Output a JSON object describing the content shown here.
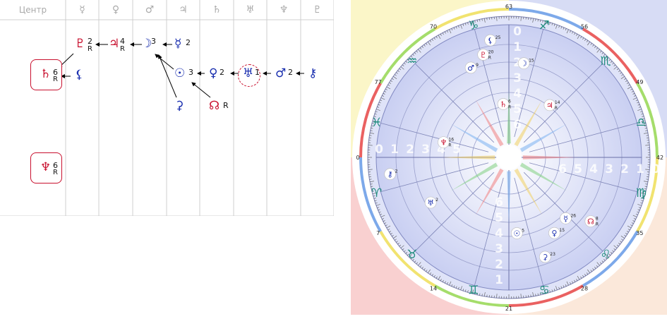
{
  "table": {
    "columns": [
      {
        "label": "Центр",
        "icon": "center-label"
      },
      {
        "label": "☿",
        "icon": "mercury-icon"
      },
      {
        "label": "♀",
        "icon": "venus-icon"
      },
      {
        "label": "♂",
        "icon": "mars-icon"
      },
      {
        "label": "♃",
        "icon": "jupiter-icon"
      },
      {
        "label": "♄",
        "icon": "saturn-icon"
      },
      {
        "label": "♅",
        "icon": "uranus-icon"
      },
      {
        "label": "♆",
        "icon": "neptune-icon"
      },
      {
        "label": "♇",
        "icon": "pluto-icon"
      }
    ],
    "nodes": {
      "pluto": {
        "glyph": "♇",
        "num": "2",
        "r": "R"
      },
      "jupiter": {
        "glyph": "♃",
        "num": "4",
        "r": "R"
      },
      "moon": {
        "glyph": "☽",
        "num": "3"
      },
      "mercury": {
        "glyph": "☿",
        "num": "2"
      },
      "saturn": {
        "glyph": "♄",
        "num": "6",
        "r": "R"
      },
      "chiron_a": {
        "glyph": "⚸"
      },
      "sun": {
        "glyph": "☉",
        "num": "3"
      },
      "venus": {
        "glyph": "♀",
        "num": "2"
      },
      "uranus": {
        "glyph": "♅",
        "num": "1"
      },
      "mars": {
        "glyph": "♂",
        "num": "2"
      },
      "chiron_b": {
        "glyph": "⚷"
      },
      "ceres": {
        "glyph": "⚳"
      },
      "node": {
        "glyph": "☊",
        "r": "R"
      },
      "neptune": {
        "glyph": "♆",
        "num": "6",
        "r": "R"
      }
    }
  },
  "wheel": {
    "sign_glyphs": [
      "♑",
      "♐",
      "♏",
      "♎",
      "♍",
      "♌",
      "♋",
      "♊",
      "♉",
      "♈",
      "♓",
      "♒"
    ],
    "degree_labels": [
      "63",
      "56",
      "49",
      "42",
      "35",
      "28",
      "21",
      "14",
      "7",
      "0",
      "77",
      "70"
    ],
    "house_numbers_left": [
      "0",
      "1",
      "2",
      "3",
      "4",
      "5"
    ],
    "house_numbers_right": [
      "6",
      "5",
      "4",
      "3",
      "2",
      "1",
      "0"
    ],
    "house_numbers_top": [
      "0",
      "1",
      "2",
      "3",
      "4",
      "5",
      "6"
    ],
    "house_numbers_bottom": [
      "6",
      "5",
      "4",
      "3",
      "2",
      "1"
    ],
    "planets": [
      {
        "glyph": "⚸",
        "num": "25",
        "name": "lilith"
      },
      {
        "glyph": "♇",
        "num": "20",
        "r": "R",
        "name": "pluto"
      },
      {
        "glyph": "♂",
        "num": "9",
        "name": "mars"
      },
      {
        "glyph": "☽",
        "num": "15",
        "name": "moon"
      },
      {
        "glyph": "♄",
        "num": "6",
        "r": "R",
        "name": "saturn"
      },
      {
        "glyph": "♃",
        "num": "14",
        "r": "R",
        "name": "jupiter"
      },
      {
        "glyph": "♆",
        "num": "16",
        "r": "R",
        "name": "neptune"
      },
      {
        "glyph": "⚷",
        "num": "2",
        "name": "chiron"
      },
      {
        "glyph": "♅",
        "num": "2",
        "name": "uranus"
      },
      {
        "glyph": "☉",
        "num": "5",
        "name": "sun"
      },
      {
        "glyph": "♀",
        "num": "15",
        "name": "venus"
      },
      {
        "glyph": "☿",
        "num": "26",
        "name": "mercury"
      },
      {
        "glyph": "⚳",
        "num": "23",
        "name": "ceres"
      },
      {
        "glyph": "☊",
        "num": "8",
        "r": "R",
        "name": "node"
      }
    ]
  }
}
